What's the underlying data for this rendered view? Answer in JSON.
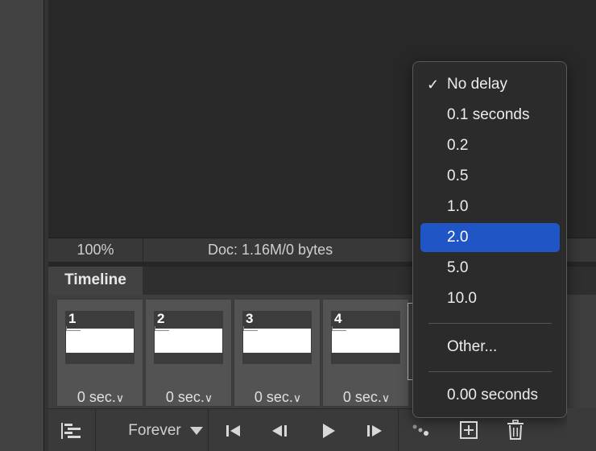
{
  "status_bar": {
    "zoom": "100%",
    "doc_info": "Doc: 1.16M/0 bytes"
  },
  "panel": {
    "tab_label": "Timeline"
  },
  "frames": [
    {
      "number": "1",
      "delay": "0 sec."
    },
    {
      "number": "2",
      "delay": "0 sec."
    },
    {
      "number": "3",
      "delay": "0 sec."
    },
    {
      "number": "4",
      "delay": "0 sec."
    }
  ],
  "controls": {
    "loop_option": "Forever"
  },
  "delay_menu": {
    "items": [
      {
        "label": "No delay",
        "checked": true
      },
      {
        "label": "0.1 seconds"
      },
      {
        "label": "0.2"
      },
      {
        "label": "0.5"
      },
      {
        "label": "1.0"
      },
      {
        "label": "2.0",
        "highlighted": true
      },
      {
        "label": "5.0"
      },
      {
        "label": "10.0"
      }
    ],
    "other_label": "Other...",
    "current_label": "0.00 seconds"
  },
  "icons": {
    "check": "✓",
    "chevron": "∨",
    "convert": "timeline-convert-icon",
    "first": "first-frame-icon",
    "prev": "previous-frame-icon",
    "play": "play-icon",
    "next": "next-frame-icon",
    "tween": "tween-icon",
    "new": "new-frame-icon",
    "trash": "trash-icon"
  },
  "colors": {
    "highlight": "#1f55c4",
    "panel": "#3e3e3e",
    "menu_bg": "#2b2b2b"
  }
}
